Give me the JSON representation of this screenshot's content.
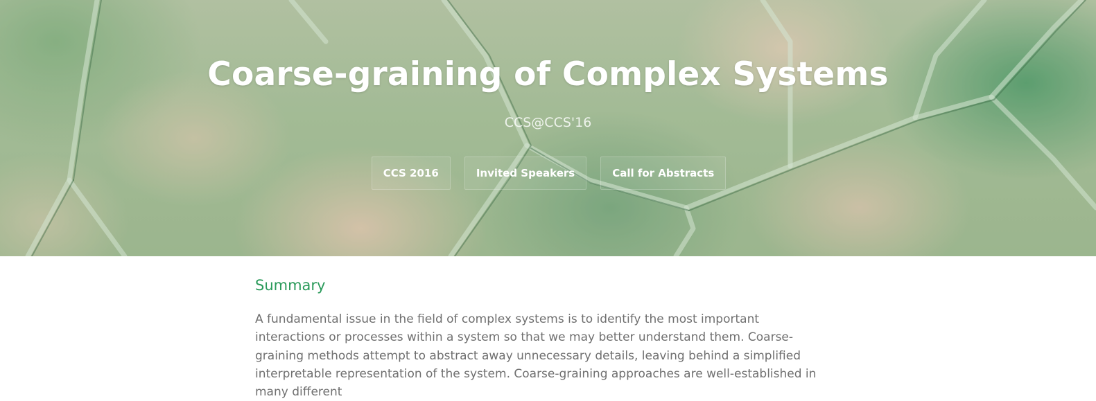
{
  "header": {
    "title": "Coarse-graining of Complex Systems",
    "subtitle": "CCS@CCS'16",
    "nav": [
      {
        "label": "CCS 2016"
      },
      {
        "label": "Invited Speakers"
      },
      {
        "label": "Call for Abstracts"
      }
    ]
  },
  "summary": {
    "heading": "Summary",
    "paragraph": "A fundamental issue in the field of complex systems is to identify the most important interactions or processes within a system so that we may better understand them. Coarse- graining methods attempt to abstract away unnecessary details, leaving behind a simplified interpretable representation of the system. Coarse-graining approaches are well-established in many different"
  },
  "colors": {
    "accent": "#2a9a5a",
    "body_text": "#6f6f6f",
    "hero_text": "#ffffff"
  }
}
